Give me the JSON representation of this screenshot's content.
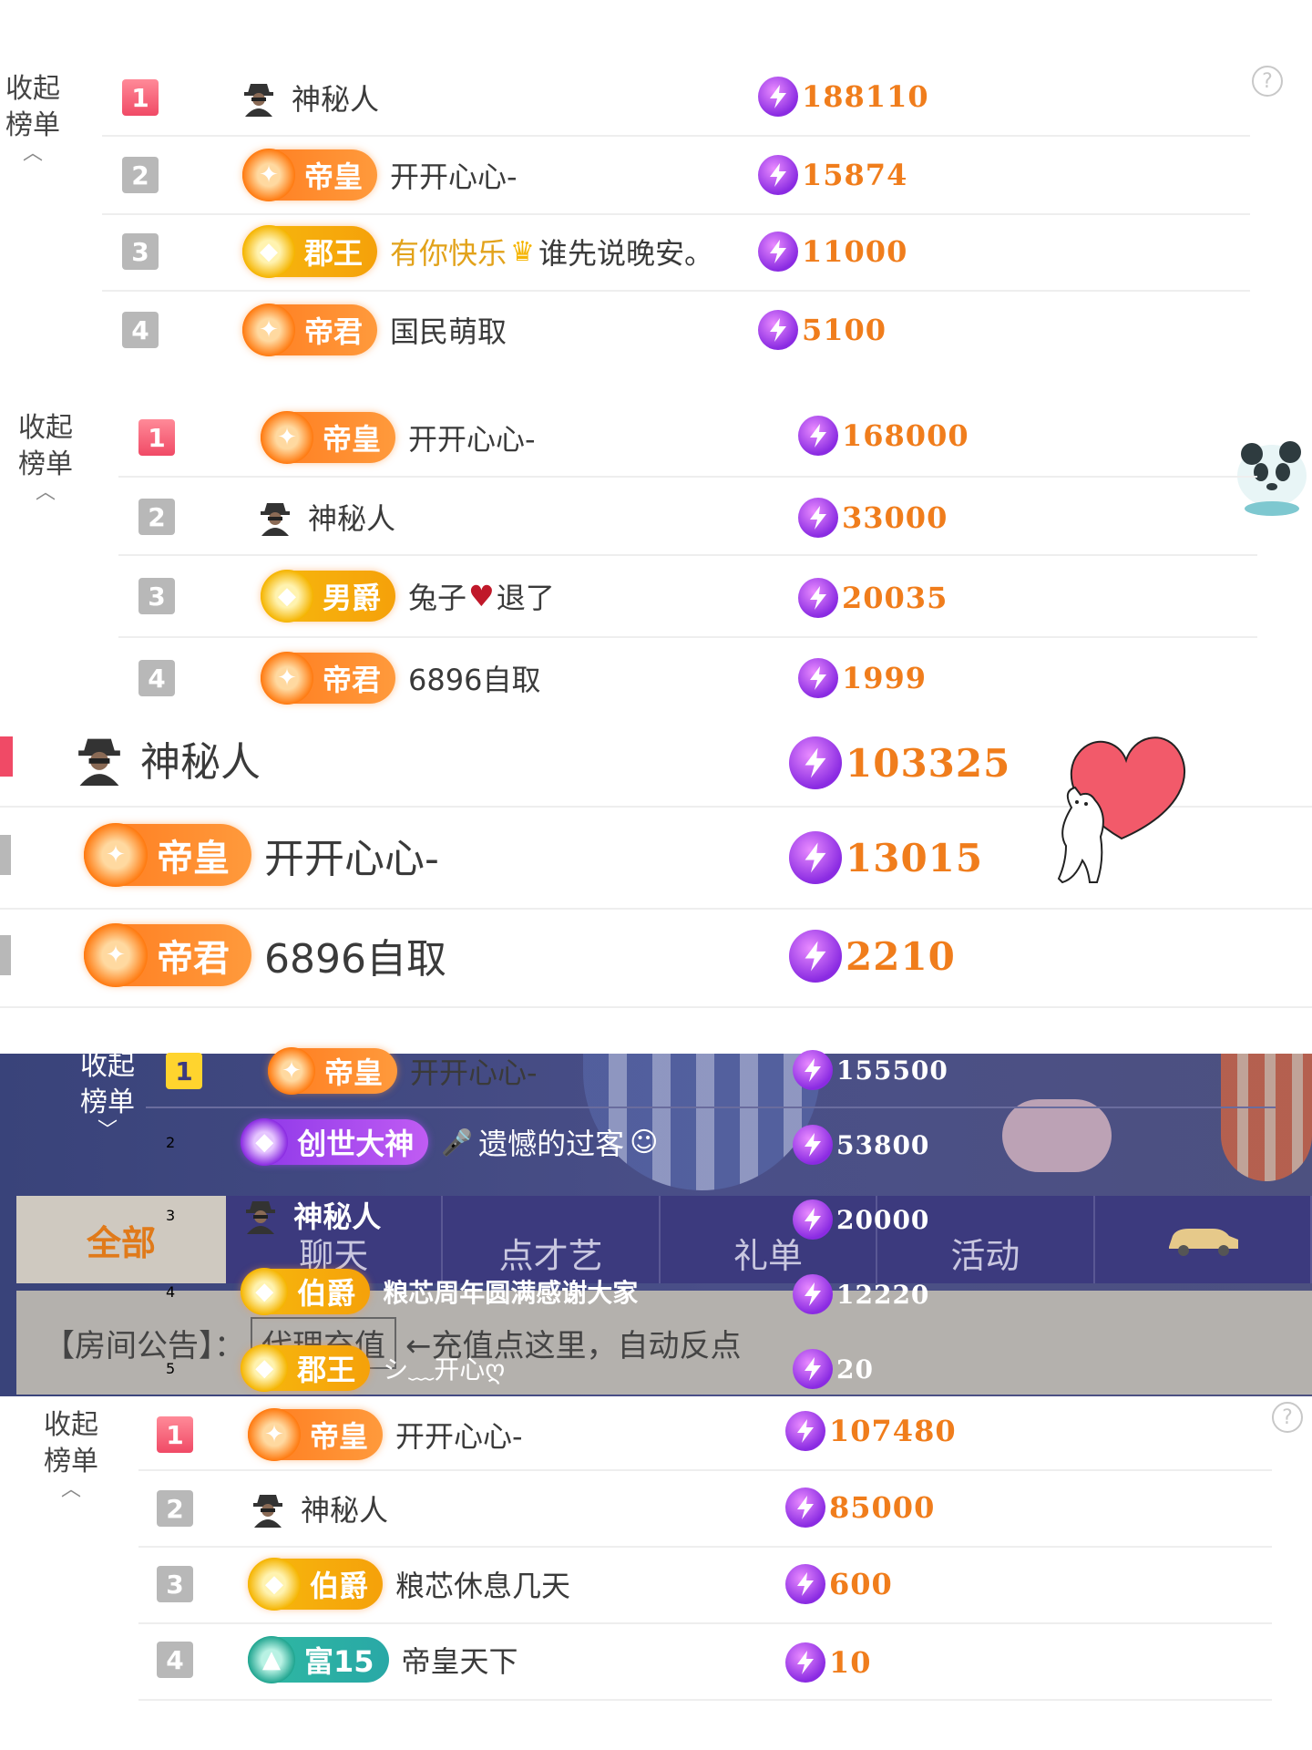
{
  "colors": {
    "accent_orange": "#f07d1c",
    "rank_first": "#f04a66",
    "bolt_purple": "#8a2be2",
    "dark_bg": "#3c3a7e"
  },
  "panels": [
    {
      "collapse_label": "收起榜单",
      "rows": [
        {
          "rank": "1",
          "badge": null,
          "name": "神秘人",
          "anonymous": true,
          "score": "188110"
        },
        {
          "rank": "2",
          "badge": {
            "label": "帝皇",
            "style": "orange"
          },
          "name": "开开心心-",
          "score": "15874"
        },
        {
          "rank": "3",
          "badge": {
            "label": "郡王",
            "style": "gold"
          },
          "name": "有你快乐",
          "name2": "谁先说晚安。",
          "crown_icon": "crown-icon",
          "score": "11000"
        },
        {
          "rank": "4",
          "badge": {
            "label": "帝君",
            "style": "orange"
          },
          "name": "国民萌取",
          "score": "5100"
        }
      ]
    },
    {
      "collapse_label": "收起榜单",
      "rows": [
        {
          "rank": "1",
          "badge": {
            "label": "帝皇",
            "style": "orange"
          },
          "name": "开开心心-",
          "score": "168000"
        },
        {
          "rank": "2",
          "badge": null,
          "name": "神秘人",
          "anonymous": true,
          "score": "33000"
        },
        {
          "rank": "3",
          "badge": {
            "label": "男爵",
            "style": "gold"
          },
          "name": "兔子",
          "name2": "退了",
          "heart_icon": "broken-heart-icon",
          "score": "20035"
        },
        {
          "rank": "4",
          "badge": {
            "label": "帝君",
            "style": "orange"
          },
          "name": "6896自取",
          "score": "1999"
        }
      ]
    },
    {
      "rows": [
        {
          "name": "神秘人",
          "anonymous": true,
          "score": "103325"
        },
        {
          "badge": {
            "label": "帝皇",
            "style": "orange"
          },
          "name": "开开心心-",
          "score": "13015"
        },
        {
          "badge": {
            "label": "帝君",
            "style": "orange"
          },
          "name": "6896自取",
          "score": "2210"
        }
      ]
    },
    {
      "collapse_label": "收起榜单",
      "rows": [
        {
          "rank": "1",
          "badge": {
            "label": "帝皇",
            "style": "orange"
          },
          "name": "开开心心-",
          "score": "155500"
        },
        {
          "rank": "2",
          "badge": {
            "label": "创世大神",
            "style": "purple"
          },
          "name": "遗憾的过客",
          "score": "53800"
        },
        {
          "rank": "3",
          "badge": null,
          "name": "神秘人",
          "anonymous": true,
          "score": "20000"
        },
        {
          "rank": "4",
          "badge": {
            "label": "伯爵",
            "style": "gold"
          },
          "name": "粮芯周年圆满感谢大家",
          "score": "12220"
        },
        {
          "rank": "5",
          "badge": {
            "label": "郡王",
            "style": "gold"
          },
          "name": "シ﹏开心ღ",
          "score": "20"
        }
      ],
      "tabs": {
        "all": "全部",
        "items": [
          "聊天",
          "点才艺",
          "礼单",
          "活动"
        ]
      },
      "notice": {
        "label": "【房间公告】：",
        "link": "代理充值",
        "text": "←充值点这里，自动反点"
      }
    },
    {
      "collapse_label": "收起榜单",
      "rows": [
        {
          "rank": "1",
          "badge": {
            "label": "帝皇",
            "style": "orange"
          },
          "name": "开开心心-",
          "score": "107480"
        },
        {
          "rank": "2",
          "badge": null,
          "name": "神秘人",
          "anonymous": true,
          "score": "85000"
        },
        {
          "rank": "3",
          "badge": {
            "label": "伯爵",
            "style": "gold"
          },
          "name": "粮芯休息几天",
          "score": "600"
        },
        {
          "rank": "4",
          "badge": {
            "label": "富15",
            "style": "teal"
          },
          "name": "帝皇天下",
          "score": "10"
        }
      ]
    }
  ]
}
